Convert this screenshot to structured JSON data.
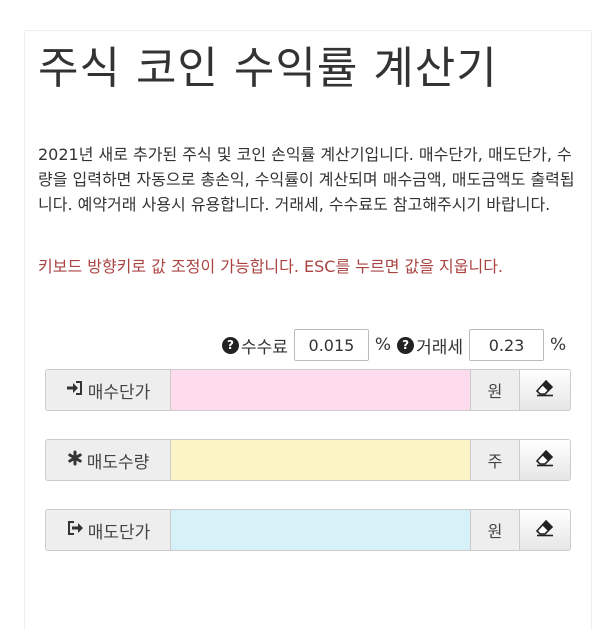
{
  "page": {
    "title": "주식 코인 수익률 계산기",
    "description": "2021년 새로 추가된 주식 및 코인 손익률 계산기입니다. 매수단가, 매도단가, 수량을 입력하면 자동으로 총손익, 수익률이 계산되며 매수금액, 매도금액도 출력됩니다. 예약거래 사용시 유용합니다. 거래세, 수수료도 참고해주시기 바랍니다.",
    "hint": "키보드 방향키로 값 조정이 가능합니다. ESC를 누르면 값을 지웁니다.",
    "hint_color": "#a94442"
  },
  "fees": {
    "commission_label": "수수료",
    "commission_value": "0.015",
    "commission_unit": "%",
    "tax_label": "거래세",
    "tax_value": "0.23",
    "tax_unit": "%"
  },
  "rows": [
    {
      "icon": "sign-in-icon",
      "label": "매수단가",
      "value": "",
      "unit": "원",
      "color": "#ffdbee",
      "clear_icon": "eraser-icon"
    },
    {
      "icon": "asterisk-icon",
      "label": "매도수량",
      "value": "",
      "unit": "주",
      "color": "#fbf4c4",
      "clear_icon": "eraser-icon"
    },
    {
      "icon": "sign-out-icon",
      "label": "매도단가",
      "value": "",
      "unit": "원",
      "color": "#d6f2f8",
      "clear_icon": "eraser-icon"
    }
  ]
}
